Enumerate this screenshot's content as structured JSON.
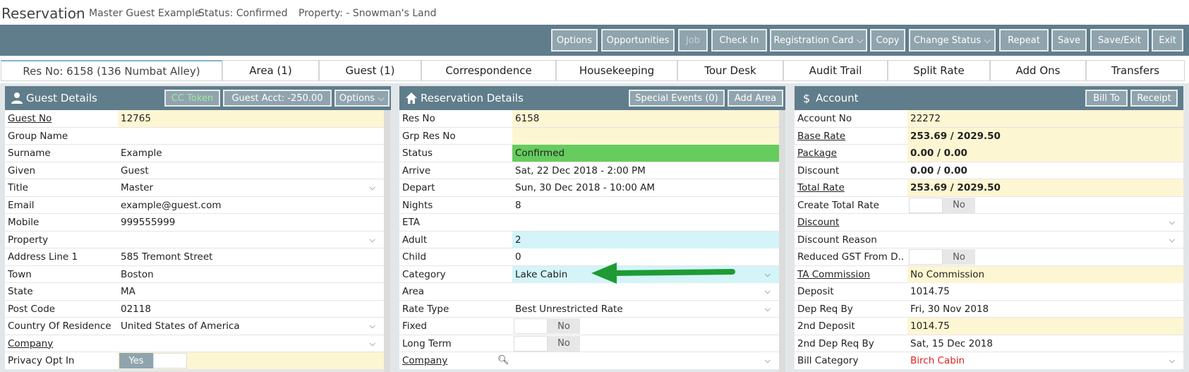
{
  "title": {
    "main": "Reservation",
    "dash": "-",
    "guest": "Master Guest Example",
    "status": "Status: Confirmed",
    "property": "Property: - Snowman's Land"
  },
  "toolbar": {
    "options": "Options",
    "opportunities": "Opportunities",
    "job": "Job",
    "check_in": "Check In",
    "registration_card": "Registration Card ⌵",
    "copy": "Copy",
    "change_status": "Change Status ⌵",
    "repeat": "Repeat",
    "save": "Save",
    "save_exit": "Save/Exit",
    "exit": "Exit"
  },
  "tabs": [
    "Res No: 6158 (136 Numbat Alley)",
    "Area (1)",
    "Guest (1)",
    "Correspondence",
    "Housekeeping",
    "Tour Desk",
    "Audit Trail",
    "Split Rate",
    "Add Ons",
    "Transfers"
  ],
  "guest_panel": {
    "title": "Guest Details",
    "cc_token": "CC Token",
    "guest_acct": "Guest Acct: -250.00",
    "options": "Options ⌵",
    "rows": [
      {
        "label": "Guest No",
        "value": "12765"
      },
      {
        "label": "Group Name",
        "value": ""
      },
      {
        "label": "Surname",
        "value": "Example"
      },
      {
        "label": "Given",
        "value": "Guest"
      },
      {
        "label": "Title",
        "value": "Master"
      },
      {
        "label": "Email",
        "value": "example@guest.com"
      },
      {
        "label": "Mobile",
        "value": "999555999"
      },
      {
        "label": "Property",
        "value": ""
      },
      {
        "label": "Address Line 1",
        "value": "585 Tremont Street"
      },
      {
        "label": "Town",
        "value": "Boston"
      },
      {
        "label": "State",
        "value": "MA"
      },
      {
        "label": "Post Code",
        "value": "02118"
      },
      {
        "label": "Country Of Residence",
        "value": "United States of America"
      },
      {
        "label": "Company",
        "value": ""
      },
      {
        "label": "Privacy Opt In",
        "value": "Yes"
      }
    ]
  },
  "res_panel": {
    "title": "Reservation Details",
    "special_events": "Special Events (0)",
    "add_area": "Add Area",
    "rows": [
      {
        "label": "Res No",
        "value": "6158"
      },
      {
        "label": "Grp Res No",
        "value": ""
      },
      {
        "label": "Status",
        "value": "Confirmed"
      },
      {
        "label": "Arrive",
        "value": "Sat, 22 Dec 2018 - 2:00 PM"
      },
      {
        "label": "Depart",
        "value": "Sun, 30 Dec 2018 - 10:00 AM"
      },
      {
        "label": "Nights",
        "value": "8"
      },
      {
        "label": "ETA",
        "value": ""
      },
      {
        "label": "Adult",
        "value": "2"
      },
      {
        "label": "Child",
        "value": "0"
      },
      {
        "label": "Category",
        "value": "Lake Cabin"
      },
      {
        "label": "Area",
        "value": ""
      },
      {
        "label": "Rate Type",
        "value": "Best Unrestricted Rate"
      },
      {
        "label": "Fixed",
        "value": "No"
      },
      {
        "label": "Long Term",
        "value": "No"
      },
      {
        "label": "Company",
        "value": ""
      }
    ]
  },
  "account_panel": {
    "title": "Account",
    "bill_to": "Bill To",
    "receipt": "Receipt",
    "rows": [
      {
        "label": "Account No",
        "value": "22272"
      },
      {
        "label": "Base Rate",
        "value": "253.69 / 2029.50"
      },
      {
        "label": "Package",
        "value": "0.00 / 0.00"
      },
      {
        "label": "Discount",
        "value": "0.00 / 0.00"
      },
      {
        "label": "Total Rate",
        "value": "253.69 / 2029.50"
      },
      {
        "label": "Create Total Rate",
        "value": "No"
      },
      {
        "label": "Discount",
        "value": ""
      },
      {
        "label": "Discount Reason",
        "value": ""
      },
      {
        "label": "Reduced GST From D...",
        "value": "No"
      },
      {
        "label": "TA Commission",
        "value": "No Commission"
      },
      {
        "label": "Deposit",
        "value": "1014.75"
      },
      {
        "label": "Dep Req By",
        "value": "Fri, 30 Nov 2018"
      },
      {
        "label": "2nd Deposit",
        "value": "1014.75"
      },
      {
        "label": "2nd Dep Req By",
        "value": "Sat, 15 Dec 2018"
      },
      {
        "label": "Bill Category",
        "value": "Birch Cabin"
      }
    ]
  },
  "colors": {
    "header": "#607d8b",
    "button": "#90a4ae",
    "highlight_yellow": "#fdf6d3",
    "status_green": "#66cc5e",
    "cyan": "#d4f4f8",
    "arrow": "#1e9b34",
    "red_text": "#dd2222"
  }
}
